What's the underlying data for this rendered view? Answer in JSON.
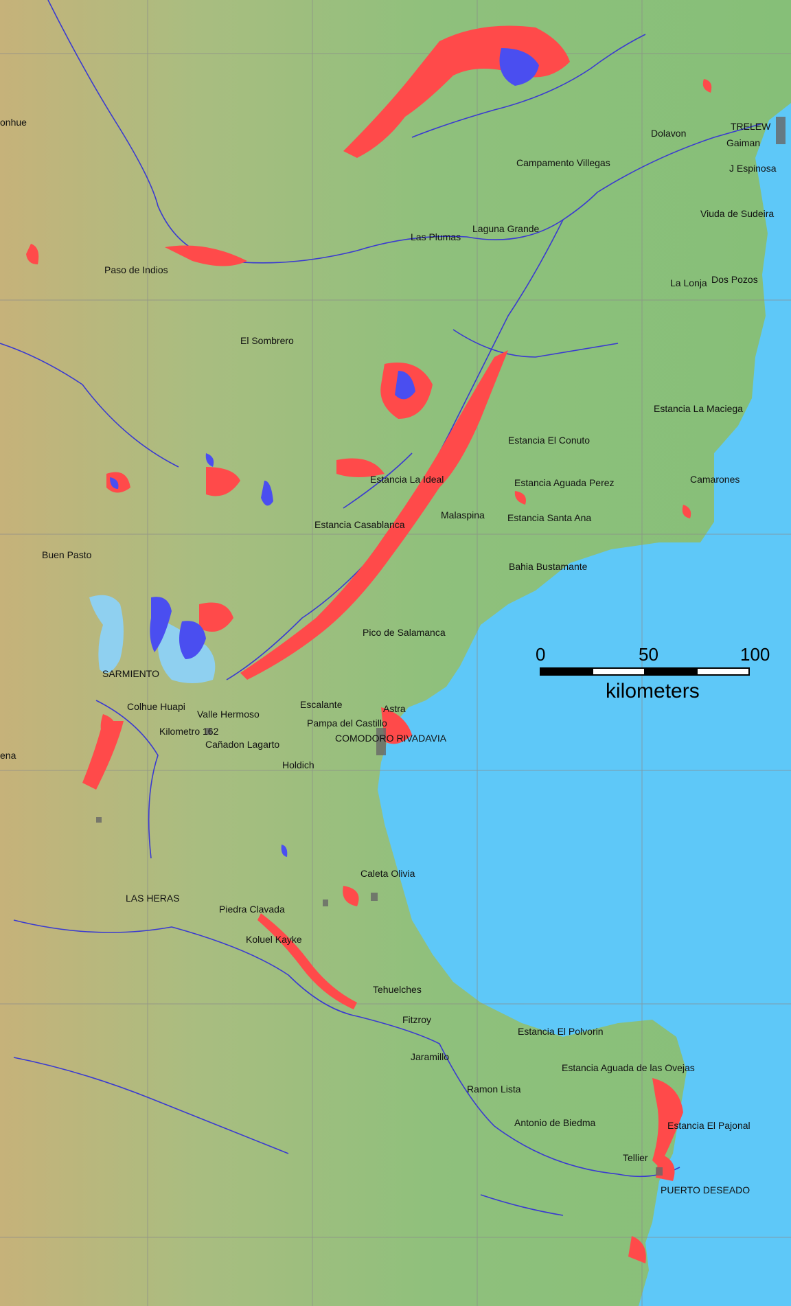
{
  "places": {
    "onhue": "onhue",
    "trelew": "TRELEW",
    "dolavon": "Dolavon",
    "gaiman": "Gaiman",
    "campamento_villegas": "Campamento Villegas",
    "j_espinosa": "J Espinosa",
    "laguna_grande": "Laguna Grande",
    "las_plumas": "Las Plumas",
    "viuda_de_sudeira": "Viuda de Sudeira",
    "paso_de_indios": "Paso de Indios",
    "la_lonja": "La Lonja",
    "dos_pozos": "Dos Pozos",
    "el_sombrero": "El Sombrero",
    "estancia_la_maciega": "Estancia La Maciega",
    "estancia_el_conuto": "Estancia El Conuto",
    "estancia_la_ideal": "Estancia La Ideal",
    "estancia_aguada_perez": "Estancia Aguada Perez",
    "camarones": "Camarones",
    "malaspina": "Malaspina",
    "estancia_santa_ana": "Estancia Santa Ana",
    "estancia_casablanca": "Estancia Casablanca",
    "buen_pasto": "Buen Pasto",
    "bahia_bustamante": "Bahia Bustamante",
    "pico_de_salamanca": "Pico de Salamanca",
    "sarmiento": "SARMIENTO",
    "escalante": "Escalante",
    "astra": "Astra",
    "colhue_huapi": "Colhue Huapi",
    "valle_hermoso": "Valle Hermoso",
    "pampa_del_castillo": "Pampa del Castillo",
    "kilometro_162": "Kilometro 162",
    "comodoro_rivadavia": "COMODORO RIVADAVIA",
    "ena": "ena",
    "canadon_lagarto": "Cañadon Lagarto",
    "holdich": "Holdich",
    "caleta_olivia": "Caleta Olivia",
    "las_heras": "LAS HERAS",
    "piedra_clavada": "Piedra Clavada",
    "koluel_kayke": "Koluel Kayke",
    "tehuelches": "Tehuelches",
    "fitzroy": "Fitzroy",
    "estancia_el_polvorin": "Estancia El Polvorin",
    "jaramillo": "Jaramillo",
    "estancia_aguada_de_las_ovejas": "Estancia Aguada de las Ovejas",
    "ramon_lista": "Ramon Lista",
    "antonio_de_biedma": "Antonio de Biedma",
    "estancia_el_pajonal": "Estancia El Pajonal",
    "tellier": "Tellier",
    "puerto_deseado": "PUERTO DESEADO"
  },
  "scale": {
    "tick_0": "0",
    "tick_50": "50",
    "tick_100": "100",
    "unit": "kilometers"
  },
  "colors": {
    "land": "#8fbf7a",
    "highland": "#c8b37a",
    "ocean": "#5ec8f8",
    "flood": "#ff4a4a",
    "water": "#4a4ef0",
    "lake_light": "#8fd0f0",
    "river": "#3a3ad0",
    "urban": "#666666",
    "grid": "#888888"
  }
}
